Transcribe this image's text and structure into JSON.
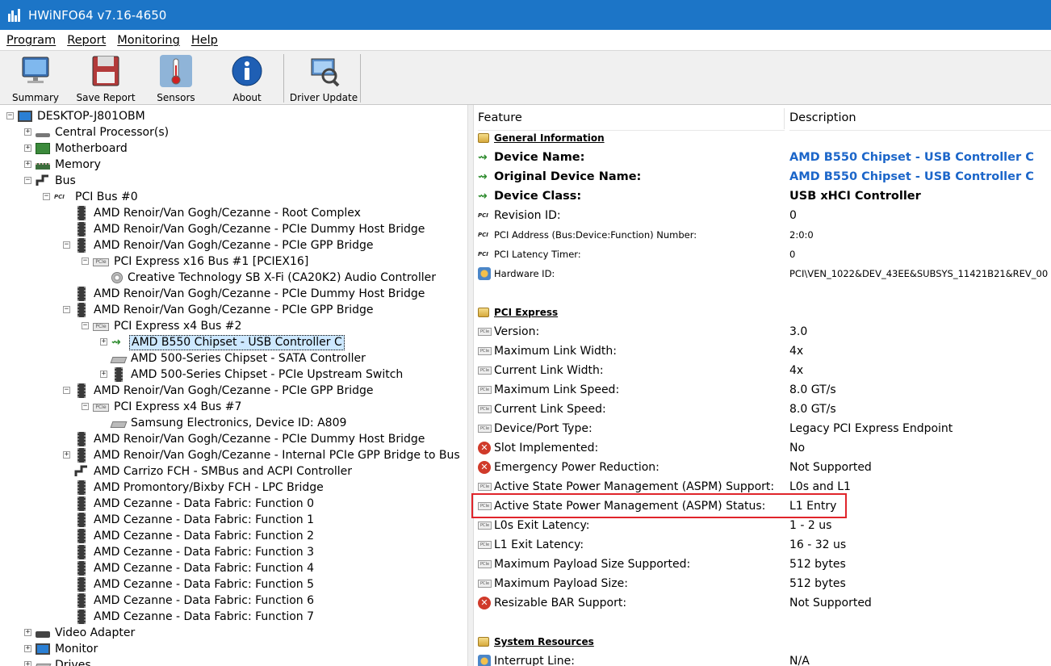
{
  "window": {
    "title": "HWiNFO64 v7.16-4650"
  },
  "menu": [
    "Program",
    "Report",
    "Monitoring",
    "Help"
  ],
  "toolbar": {
    "summary": "Summary",
    "save_report": "Save Report",
    "sensors": "Sensors",
    "about": "About",
    "driver_update": "Driver Update"
  },
  "tree": [
    {
      "label": "DESKTOP-J801OBM",
      "icon": "monitor"
    },
    {
      "label": "Central Processor(s)",
      "icon": "cpu-thin"
    },
    {
      "label": "Motherboard",
      "icon": "mobo"
    },
    {
      "label": "Memory",
      "icon": "mem"
    },
    {
      "label": "Bus",
      "icon": "bus"
    },
    {
      "label": "PCI Bus #0",
      "icon": "pci-text"
    },
    {
      "label": "AMD Renoir/Van Gogh/Cezanne - Root Complex",
      "icon": "chip"
    },
    {
      "label": "AMD Renoir/Van Gogh/Cezanne - PCIe Dummy Host Bridge",
      "icon": "chip"
    },
    {
      "label": "AMD Renoir/Van Gogh/Cezanne - PCIe GPP Bridge",
      "icon": "chip"
    },
    {
      "label": "PCI Express x16 Bus #1 [PCIEX16]",
      "icon": "pcie"
    },
    {
      "label": "Creative Technology SB X-Fi (CA20K2) Audio Controller",
      "icon": "disc"
    },
    {
      "label": "AMD Renoir/Van Gogh/Cezanne - PCIe Dummy Host Bridge",
      "icon": "chip"
    },
    {
      "label": "AMD Renoir/Van Gogh/Cezanne - PCIe GPP Bridge",
      "icon": "chip"
    },
    {
      "label": "PCI Express x4 Bus #2",
      "icon": "pcie"
    },
    {
      "label": "AMD B550 Chipset - USB Controller C",
      "icon": "usb"
    },
    {
      "label": "AMD 500-Series Chipset - SATA Controller",
      "icon": "drive"
    },
    {
      "label": "AMD 500-Series Chipset - PCIe Upstream Switch",
      "icon": "chip"
    },
    {
      "label": "AMD Renoir/Van Gogh/Cezanne - PCIe GPP Bridge",
      "icon": "chip"
    },
    {
      "label": "PCI Express x4 Bus #7",
      "icon": "pcie"
    },
    {
      "label": "Samsung Electronics, Device ID: A809",
      "icon": "drive"
    },
    {
      "label": "AMD Renoir/Van Gogh/Cezanne - PCIe Dummy Host Bridge",
      "icon": "chip"
    },
    {
      "label": "AMD Renoir/Van Gogh/Cezanne - Internal PCIe GPP Bridge to Bus",
      "icon": "chip"
    },
    {
      "label": "AMD Carrizo FCH - SMBus and ACPI Controller",
      "icon": "bus"
    },
    {
      "label": "AMD Promontory/Bixby FCH - LPC Bridge",
      "icon": "chip"
    },
    {
      "label": "AMD Cezanne - Data Fabric: Function 0",
      "icon": "chip"
    },
    {
      "label": "AMD Cezanne - Data Fabric: Function 1",
      "icon": "chip"
    },
    {
      "label": "AMD Cezanne - Data Fabric: Function 2",
      "icon": "chip"
    },
    {
      "label": "AMD Cezanne - Data Fabric: Function 3",
      "icon": "chip"
    },
    {
      "label": "AMD Cezanne - Data Fabric: Function 4",
      "icon": "chip"
    },
    {
      "label": "AMD Cezanne - Data Fabric: Function 5",
      "icon": "chip"
    },
    {
      "label": "AMD Cezanne - Data Fabric: Function 6",
      "icon": "chip"
    },
    {
      "label": "AMD Cezanne - Data Fabric: Function 7",
      "icon": "chip"
    },
    {
      "label": "Video Adapter",
      "icon": "video"
    },
    {
      "label": "Monitor",
      "icon": "monitor"
    },
    {
      "label": "Drives",
      "icon": "drive"
    }
  ],
  "details": {
    "header_feature": "Feature",
    "header_description": "Description",
    "rows": [
      {
        "name": "General Information",
        "value": "",
        "kind": "section"
      },
      {
        "name": "Device Name:",
        "value": "AMD B550 Chipset - USB Controller C",
        "kind": "bold-link",
        "icon": "usb"
      },
      {
        "name": "Original Device Name:",
        "value": "AMD B550 Chipset - USB Controller C",
        "kind": "bold-link",
        "icon": "usb"
      },
      {
        "name": "Device Class:",
        "value": "USB xHCI Controller",
        "kind": "bold",
        "icon": "usb"
      },
      {
        "name": "Revision ID:",
        "value": "0",
        "kind": "normal",
        "icon": "pci"
      },
      {
        "name": "PCI Address (Bus:Device:Function) Number:",
        "value": "2:0:0",
        "kind": "small",
        "icon": "pci"
      },
      {
        "name": "PCI Latency Timer:",
        "value": "0",
        "kind": "small",
        "icon": "pci"
      },
      {
        "name": "Hardware ID:",
        "value": "PCI\\VEN_1022&DEV_43EE&SUBSYS_11421B21&REV_00",
        "kind": "small",
        "icon": "hw"
      },
      {
        "name": "",
        "value": "",
        "kind": "blank"
      },
      {
        "name": "PCI Express",
        "value": "",
        "kind": "section"
      },
      {
        "name": "Version:",
        "value": "3.0",
        "kind": "normal",
        "icon": "pcie"
      },
      {
        "name": "Maximum Link Width:",
        "value": "4x",
        "kind": "normal",
        "icon": "pcie"
      },
      {
        "name": "Current Link Width:",
        "value": "4x",
        "kind": "normal",
        "icon": "pcie"
      },
      {
        "name": "Maximum Link Speed:",
        "value": "8.0 GT/s",
        "kind": "normal",
        "icon": "pcie"
      },
      {
        "name": "Current Link Speed:",
        "value": "8.0 GT/s",
        "kind": "normal",
        "icon": "pcie"
      },
      {
        "name": "Device/Port Type:",
        "value": "Legacy PCI Express Endpoint",
        "kind": "normal",
        "icon": "pcie"
      },
      {
        "name": "Slot Implemented:",
        "value": "No",
        "kind": "normal",
        "icon": "err"
      },
      {
        "name": "Emergency Power Reduction:",
        "value": "Not Supported",
        "kind": "normal",
        "icon": "err"
      },
      {
        "name": "Active State Power Management (ASPM) Support:",
        "value": "L0s and L1",
        "kind": "normal",
        "icon": "pcie"
      },
      {
        "name": "Active State Power Management (ASPM) Status:",
        "value": "L1 Entry",
        "kind": "normal",
        "icon": "pcie"
      },
      {
        "name": "L0s Exit Latency:",
        "value": "1 - 2 us",
        "kind": "normal",
        "icon": "pcie"
      },
      {
        "name": "L1 Exit Latency:",
        "value": "16 - 32 us",
        "kind": "normal",
        "icon": "pcie"
      },
      {
        "name": "Maximum Payload Size Supported:",
        "value": "512 bytes",
        "kind": "normal",
        "icon": "pcie"
      },
      {
        "name": "Maximum Payload Size:",
        "value": "512 bytes",
        "kind": "normal",
        "icon": "pcie"
      },
      {
        "name": "Resizable BAR Support:",
        "value": "Not Supported",
        "kind": "normal",
        "icon": "err"
      },
      {
        "name": "",
        "value": "",
        "kind": "blank"
      },
      {
        "name": "System Resources",
        "value": "",
        "kind": "section"
      },
      {
        "name": "Interrupt Line:",
        "value": "N/A",
        "kind": "normal",
        "icon": "hw"
      }
    ]
  },
  "colors": {
    "titlebar": "#1c75c7",
    "link": "#1c66c9",
    "highlight": "#e0252b",
    "selection": "#cde8ff"
  }
}
